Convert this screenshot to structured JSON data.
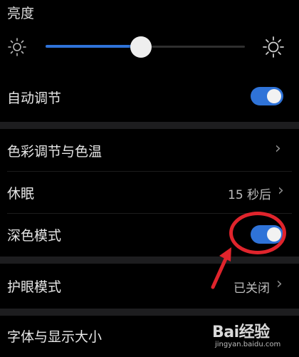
{
  "brightness": {
    "title": "亮度",
    "level": 0.48,
    "low_icon": "sun-dim-icon",
    "high_icon": "sun-bright-icon"
  },
  "auto_adjust": {
    "label": "自动调节",
    "on": true
  },
  "color_temp": {
    "label": "色彩调节与色温"
  },
  "sleep": {
    "label": "休眠",
    "value": "15 秒后"
  },
  "dark_mode": {
    "label": "深色模式",
    "on": true
  },
  "eye_comfort": {
    "label": "护眼模式",
    "value": "已关闭"
  },
  "font_size": {
    "label": "字体与显示大小"
  },
  "watermark": {
    "main": "Bai经验",
    "sub": "jingyan.baidu.com"
  },
  "colors": {
    "accent": "#2f73d8",
    "annotation": "#e0242c",
    "background": "#000000"
  }
}
